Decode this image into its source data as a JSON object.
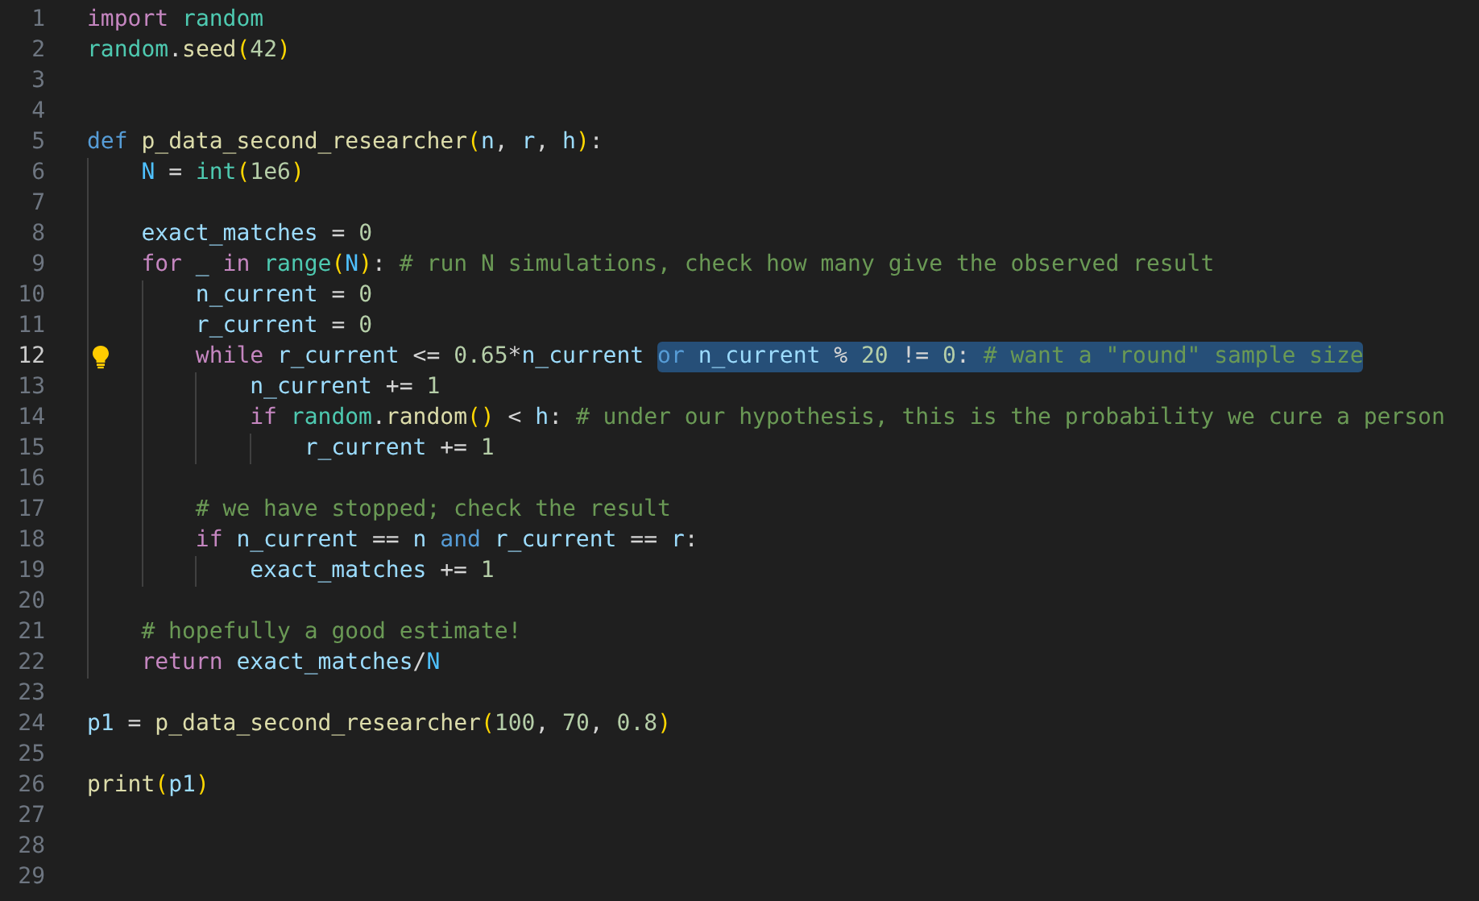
{
  "editor": {
    "lines": [
      {
        "number": "1",
        "current": false,
        "hint": false,
        "tokens": [
          {
            "text": "import ",
            "kind": "kw"
          },
          {
            "text": "random",
            "kind": "cls"
          }
        ]
      },
      {
        "number": "2",
        "current": false,
        "hint": false,
        "tokens": [
          {
            "text": "random",
            "kind": "cls"
          },
          {
            "text": ".",
            "kind": "op"
          },
          {
            "text": "seed",
            "kind": "fn"
          },
          {
            "text": "(",
            "kind": "br"
          },
          {
            "text": "42",
            "kind": "num"
          },
          {
            "text": ")",
            "kind": "br"
          }
        ]
      },
      {
        "number": "3",
        "current": false,
        "hint": false
      },
      {
        "number": "4",
        "current": false,
        "hint": false
      },
      {
        "number": "5",
        "current": false,
        "hint": false,
        "tokens": [
          {
            "text": "def ",
            "kind": "def"
          },
          {
            "text": "p_data_second_researcher",
            "kind": "fn"
          },
          {
            "text": "(",
            "kind": "br"
          },
          {
            "text": "n",
            "kind": "var"
          },
          {
            "text": ", ",
            "kind": "op"
          },
          {
            "text": "r",
            "kind": "var"
          },
          {
            "text": ", ",
            "kind": "op"
          },
          {
            "text": "h",
            "kind": "var"
          },
          {
            "text": ")",
            "kind": "br"
          },
          {
            "text": ":",
            "kind": "op"
          }
        ],
        "children": [
          {
            "number": "6",
            "current": false,
            "hint": false,
            "tokens": [
              {
                "text": "N",
                "kind": "const"
              },
              {
                "text": " = ",
                "kind": "op"
              },
              {
                "text": "int",
                "kind": "cls"
              },
              {
                "text": "(",
                "kind": "br"
              },
              {
                "text": "1e6",
                "kind": "num"
              },
              {
                "text": ")",
                "kind": "br"
              }
            ]
          },
          {
            "number": "7",
            "current": false,
            "hint": false
          },
          {
            "number": "8",
            "current": false,
            "hint": false,
            "tokens": [
              {
                "text": "exact_matches",
                "kind": "var"
              },
              {
                "text": " = ",
                "kind": "op"
              },
              {
                "text": "0",
                "kind": "num"
              }
            ]
          },
          {
            "number": "9",
            "current": false,
            "hint": false,
            "tokens": [
              {
                "text": "for ",
                "kind": "kw"
              },
              {
                "text": "_ ",
                "kind": "var"
              },
              {
                "text": "in ",
                "kind": "kw"
              },
              {
                "text": "range",
                "kind": "cls"
              },
              {
                "text": "(",
                "kind": "br"
              },
              {
                "text": "N",
                "kind": "const"
              },
              {
                "text": ")",
                "kind": "br"
              },
              {
                "text": ": ",
                "kind": "op"
              },
              {
                "text": "# run N simulations, check how many give the observed result",
                "kind": "cmt"
              }
            ],
            "children": [
              {
                "number": "10",
                "current": false,
                "hint": false,
                "tokens": [
                  {
                    "text": "n_current",
                    "kind": "var"
                  },
                  {
                    "text": " = ",
                    "kind": "op"
                  },
                  {
                    "text": "0",
                    "kind": "num"
                  }
                ]
              },
              {
                "number": "11",
                "current": false,
                "hint": false,
                "tokens": [
                  {
                    "text": "r_current",
                    "kind": "var"
                  },
                  {
                    "text": " = ",
                    "kind": "op"
                  },
                  {
                    "text": "0",
                    "kind": "num"
                  }
                ]
              },
              {
                "number": "12",
                "current": true,
                "hint": true,
                "tokens": [
                  {
                    "text": "while ",
                    "kind": "kw"
                  },
                  {
                    "text": "r_current",
                    "kind": "var"
                  },
                  {
                    "text": " <= ",
                    "kind": "op"
                  },
                  {
                    "text": "0.65",
                    "kind": "num"
                  },
                  {
                    "text": "*",
                    "kind": "op"
                  },
                  {
                    "text": "n_current ",
                    "kind": "var"
                  }
                ],
                "selection": [
                  {
                    "text": "or ",
                    "kind": "def"
                  },
                  {
                    "text": "n_current",
                    "kind": "var"
                  },
                  {
                    "text": " % ",
                    "kind": "op"
                  },
                  {
                    "text": "20",
                    "kind": "num"
                  },
                  {
                    "text": " != ",
                    "kind": "op"
                  },
                  {
                    "text": "0",
                    "kind": "num"
                  },
                  {
                    "text": ": ",
                    "kind": "op"
                  },
                  {
                    "text": "# want a \"round\" sample size",
                    "kind": "cmt"
                  }
                ],
                "children": [
                  {
                    "number": "13",
                    "current": false,
                    "hint": false,
                    "tokens": [
                      {
                        "text": "n_current",
                        "kind": "var"
                      },
                      {
                        "text": " += ",
                        "kind": "op"
                      },
                      {
                        "text": "1",
                        "kind": "num"
                      }
                    ]
                  },
                  {
                    "number": "14",
                    "current": false,
                    "hint": false,
                    "tokens": [
                      {
                        "text": "if ",
                        "kind": "kw"
                      },
                      {
                        "text": "random",
                        "kind": "cls"
                      },
                      {
                        "text": ".",
                        "kind": "op"
                      },
                      {
                        "text": "random",
                        "kind": "fn"
                      },
                      {
                        "text": "()",
                        "kind": "br"
                      },
                      {
                        "text": " < ",
                        "kind": "op"
                      },
                      {
                        "text": "h",
                        "kind": "var"
                      },
                      {
                        "text": ": ",
                        "kind": "op"
                      },
                      {
                        "text": "# under our hypothesis, this is the probability we cure a person",
                        "kind": "cmt"
                      }
                    ],
                    "children": [
                      {
                        "number": "15",
                        "current": false,
                        "hint": false,
                        "tokens": [
                          {
                            "text": "r_current",
                            "kind": "var"
                          },
                          {
                            "text": " += ",
                            "kind": "op"
                          },
                          {
                            "text": "1",
                            "kind": "num"
                          }
                        ]
                      }
                    ]
                  }
                ]
              },
              {
                "number": "16",
                "current": false,
                "hint": false
              },
              {
                "number": "17",
                "current": false,
                "hint": false,
                "tokens": [
                  {
                    "text": "# we have stopped; check the result",
                    "kind": "cmt"
                  }
                ]
              },
              {
                "number": "18",
                "current": false,
                "hint": false,
                "tokens": [
                  {
                    "text": "if ",
                    "kind": "kw"
                  },
                  {
                    "text": "n_current",
                    "kind": "var"
                  },
                  {
                    "text": " == ",
                    "kind": "op"
                  },
                  {
                    "text": "n ",
                    "kind": "var"
                  },
                  {
                    "text": "and ",
                    "kind": "def"
                  },
                  {
                    "text": "r_current",
                    "kind": "var"
                  },
                  {
                    "text": " == ",
                    "kind": "op"
                  },
                  {
                    "text": "r",
                    "kind": "var"
                  },
                  {
                    "text": ":",
                    "kind": "op"
                  }
                ],
                "children": [
                  {
                    "number": "19",
                    "current": false,
                    "hint": false,
                    "tokens": [
                      {
                        "text": "exact_matches",
                        "kind": "var"
                      },
                      {
                        "text": " += ",
                        "kind": "op"
                      },
                      {
                        "text": "1",
                        "kind": "num"
                      }
                    ]
                  }
                ]
              }
            ]
          },
          {
            "number": "20",
            "current": false,
            "hint": false
          },
          {
            "number": "21",
            "current": false,
            "hint": false,
            "tokens": [
              {
                "text": "# hopefully a good estimate!",
                "kind": "cmt"
              }
            ]
          },
          {
            "number": "22",
            "current": false,
            "hint": false,
            "tokens": [
              {
                "text": "return ",
                "kind": "kw"
              },
              {
                "text": "exact_matches",
                "kind": "var"
              },
              {
                "text": "/",
                "kind": "op"
              },
              {
                "text": "N",
                "kind": "const"
              }
            ]
          }
        ]
      },
      {
        "number": "23",
        "current": false,
        "hint": false
      },
      {
        "number": "24",
        "current": false,
        "hint": false,
        "tokens": [
          {
            "text": "p1",
            "kind": "var"
          },
          {
            "text": " = ",
            "kind": "op"
          },
          {
            "text": "p_data_second_researcher",
            "kind": "fn"
          },
          {
            "text": "(",
            "kind": "br"
          },
          {
            "text": "100",
            "kind": "num"
          },
          {
            "text": ", ",
            "kind": "op"
          },
          {
            "text": "70",
            "kind": "num"
          },
          {
            "text": ", ",
            "kind": "op"
          },
          {
            "text": "0.8",
            "kind": "num"
          },
          {
            "text": ")",
            "kind": "br"
          }
        ]
      },
      {
        "number": "25",
        "current": false,
        "hint": false
      },
      {
        "number": "26",
        "current": false,
        "hint": false,
        "tokens": [
          {
            "text": "print",
            "kind": "fn"
          },
          {
            "text": "(",
            "kind": "br"
          },
          {
            "text": "p1",
            "kind": "var"
          },
          {
            "text": ")",
            "kind": "br"
          }
        ]
      },
      {
        "number": "27",
        "current": false,
        "hint": false
      },
      {
        "number": "28",
        "current": false,
        "hint": false
      },
      {
        "number": "29",
        "current": false,
        "hint": false
      }
    ]
  }
}
